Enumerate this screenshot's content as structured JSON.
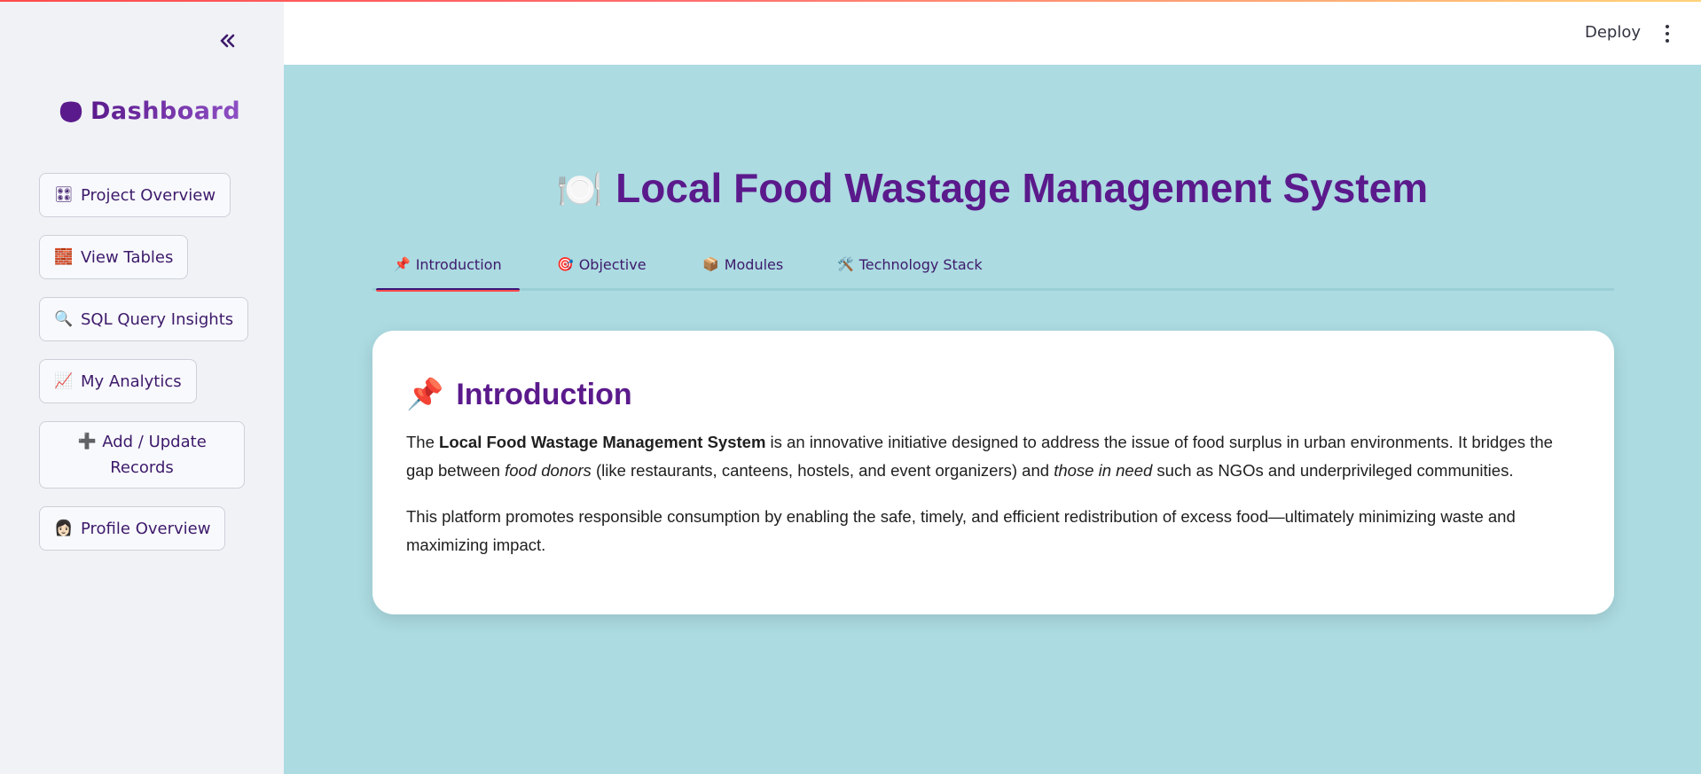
{
  "colors": {
    "accent": "#5b1a8c",
    "sidebar_bg": "#f0f2f6",
    "main_bg": "#acdbe2",
    "tab_indicator": "#ff4b4b"
  },
  "sidebar": {
    "collapse_icon": "double-chevron-left-icon",
    "brand": {
      "icon": "purple-circle-icon",
      "label": "Dashboard"
    },
    "items": [
      {
        "icon": "🎛",
        "label": "Project Overview"
      },
      {
        "icon": "🧱",
        "label": "View Tables"
      },
      {
        "icon": "🔍",
        "label": "SQL Query Insights"
      },
      {
        "icon": "📈",
        "label": "My Analytics"
      },
      {
        "icon": "➕",
        "label_line1": "Add / Update",
        "label_line2": "Records"
      },
      {
        "icon": "👩🏻",
        "label": "Profile Overview"
      }
    ]
  },
  "header": {
    "deploy_label": "Deploy",
    "menu_icon": "vertical-dots-icon"
  },
  "main": {
    "title_icon": "🍽️",
    "title": "Local Food Wastage Management System",
    "tabs": [
      {
        "icon": "📌",
        "label": "Introduction",
        "active": true
      },
      {
        "icon": "🎯",
        "label": "Objective"
      },
      {
        "icon": "📦",
        "label": "Modules"
      },
      {
        "icon": "🛠️",
        "label": "Technology Stack"
      }
    ],
    "card": {
      "icon": "📌",
      "heading": "Introduction",
      "p1": {
        "t1": "The ",
        "b1": "Local Food Wastage Management System",
        "t2": " is an innovative initiative designed to address the issue of food surplus in urban environments. It bridges the gap between ",
        "i1": "food donors",
        "t3": " (like restaurants, canteens, hostels, and event organizers) and ",
        "i2": "those in need",
        "t4": " such as NGOs and underprivileged communities."
      },
      "p2": "This platform promotes responsible consumption by enabling the safe, timely, and efficient redistribution of excess food—ultimately minimizing waste and maximizing impact."
    }
  }
}
